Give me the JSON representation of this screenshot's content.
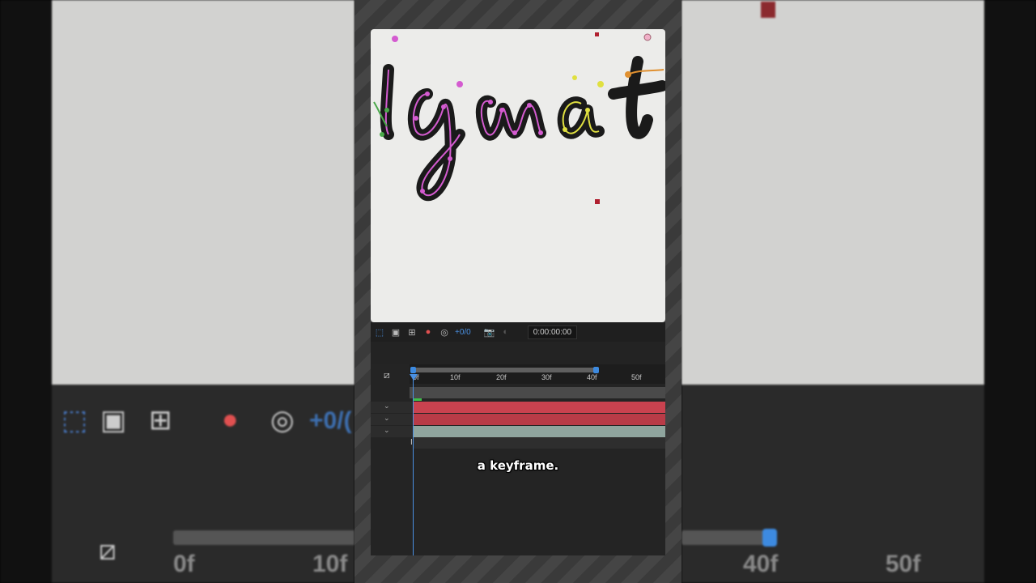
{
  "toolbar": {
    "exposure_label": "+0/0",
    "timecode": "0:00:00:00",
    "icons": [
      "region-of-interest-icon",
      "toggle-transparency-grid-icon",
      "guides-icon",
      "channel-icon",
      "exposure-icon",
      "snapshot-icon",
      "show-snapshot-icon"
    ]
  },
  "timeline": {
    "ticks": [
      "0f",
      "10f",
      "20f",
      "30f",
      "40f",
      "50f"
    ],
    "layer_colors": [
      "#c9424f",
      "#b83b47",
      "#8fa59e"
    ]
  },
  "canvas": {
    "text_fragment": "ignat"
  },
  "subtitle": "a keyframe.",
  "background": {
    "ticks": [
      "0f",
      "10f",
      "40f",
      "50f"
    ],
    "exposure_label": "+0/("
  }
}
